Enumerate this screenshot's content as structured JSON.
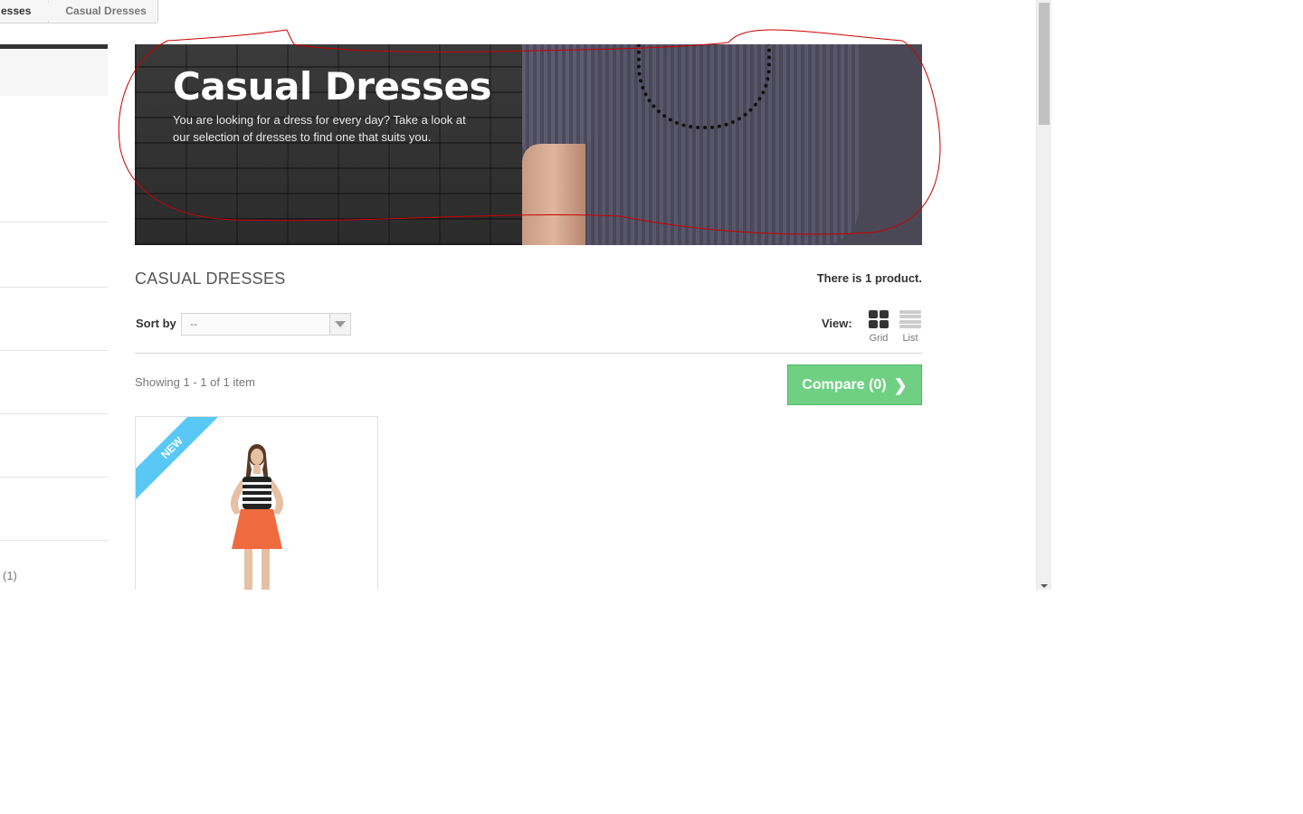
{
  "breadcrumb": {
    "items": [
      "esses",
      "Casual Dresses"
    ]
  },
  "sidebar": {
    "filter_count": "(1)"
  },
  "banner": {
    "title": "Casual Dresses",
    "description": "You are looking for a dress for every day? Take a look at our selection of dresses to find one that suits you."
  },
  "heading": {
    "title": "CASUAL DRESSES",
    "counter": "There is 1 product."
  },
  "sort": {
    "label": "Sort by",
    "selected": "--"
  },
  "view": {
    "label": "View:",
    "grid_label": "Grid",
    "list_label": "List",
    "active": "grid"
  },
  "listing": {
    "showing": "Showing 1 - 1 of 1 item",
    "compare_label": "Compare (0)"
  },
  "product": {
    "badge": "NEW"
  },
  "colors": {
    "compare": "#6fd083",
    "ribbon": "#5ac8f5",
    "annotation": "#cc0000"
  }
}
